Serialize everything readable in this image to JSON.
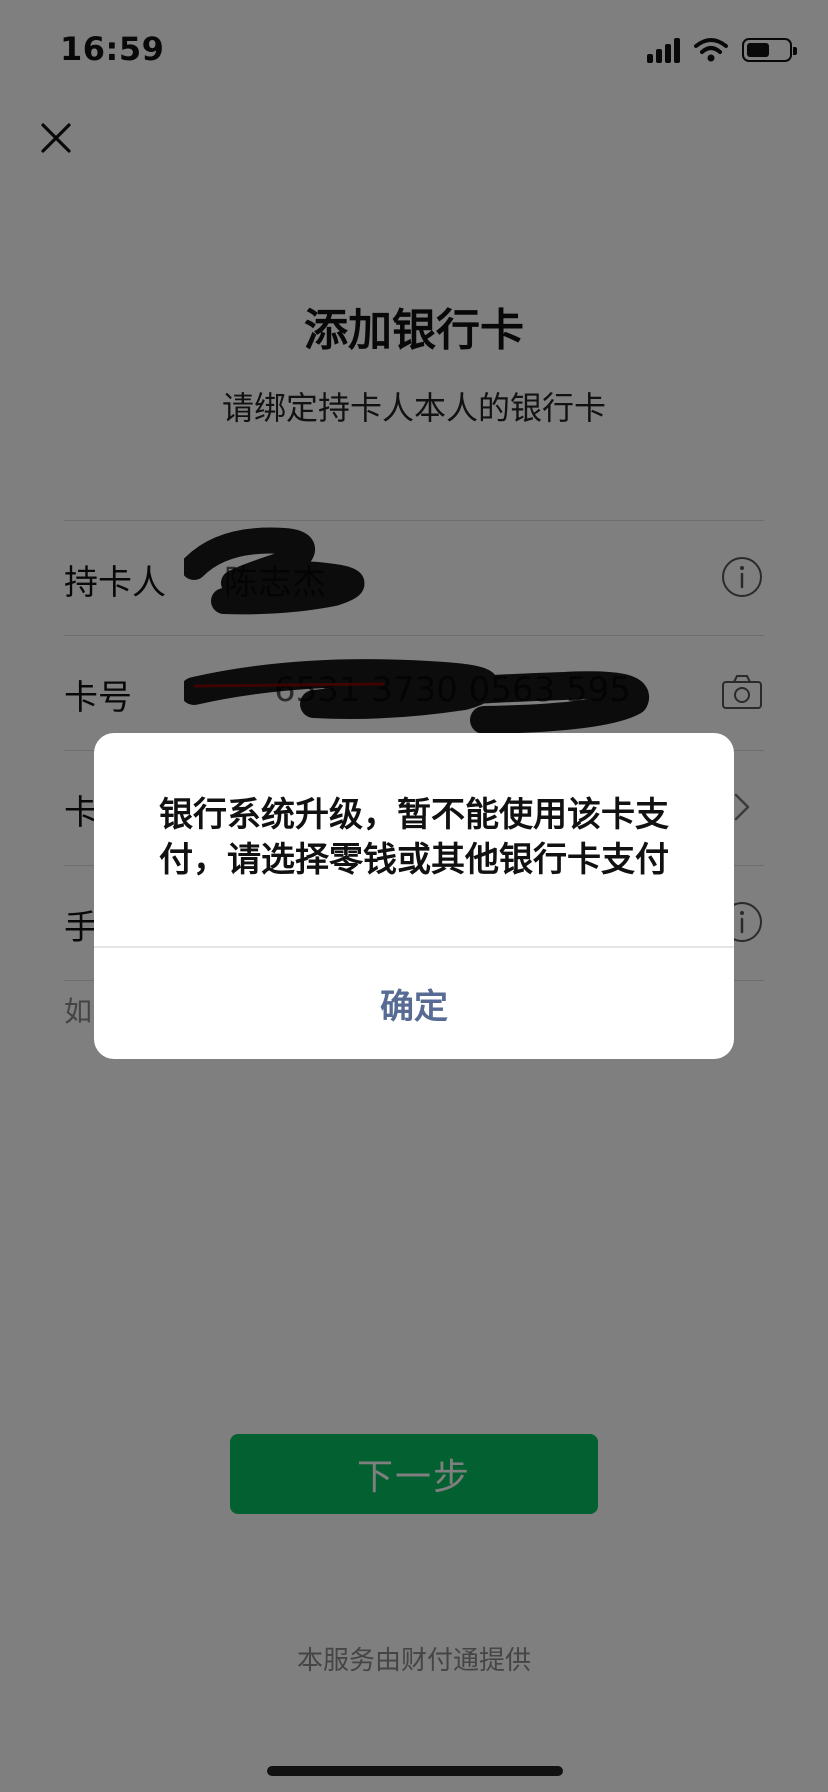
{
  "status_bar": {
    "time": "16:59"
  },
  "header": {
    "title": "添加银行卡",
    "subtitle": "请绑定持卡人本人的银行卡"
  },
  "form": {
    "rows": [
      {
        "label": "持卡人",
        "value": "陈志杰",
        "icon": "info-icon"
      },
      {
        "label": "卡号",
        "value": "6531 3730 0563 595",
        "icon": "camera-icon"
      },
      {
        "label": "卡",
        "value": "",
        "icon": "chevron-right-icon"
      },
      {
        "label": "手",
        "value": "",
        "icon": "info-icon"
      }
    ],
    "hint": "如"
  },
  "actions": {
    "next": "下一步"
  },
  "footer": {
    "text": "本服务由财付通提供"
  },
  "dialog": {
    "message": "银行系统升级，暂不能使用该卡支付，请选择零钱或其他银行卡支付",
    "confirm": "确定"
  },
  "colors": {
    "primary_button": "#07c160",
    "dialog_link": "#576b95",
    "mask": "rgba(0,0,0,0.5)"
  }
}
